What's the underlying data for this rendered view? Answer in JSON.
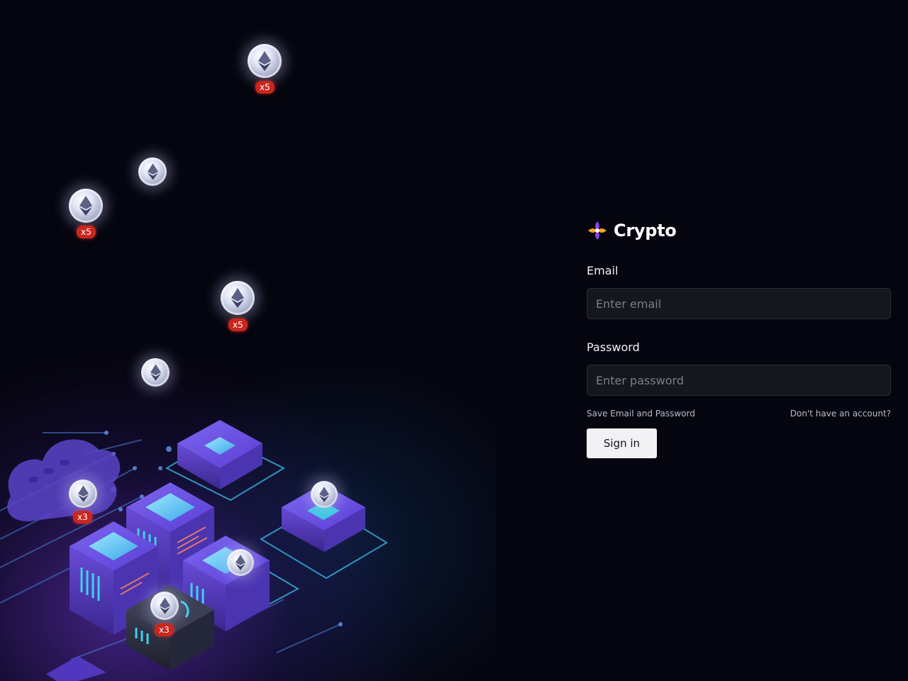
{
  "brand": {
    "name": "Crypto",
    "logo_icon": "flower-logo-icon",
    "logo_colors": [
      "#f5a623",
      "#8e44ec",
      "#ffffff"
    ]
  },
  "login": {
    "email_label": "Email",
    "email_placeholder": "Enter email",
    "email_value": "",
    "password_label": "Password",
    "password_placeholder": "Enter password",
    "password_value": "",
    "save_credentials_label": "Save Email and Password",
    "no_account_link": "Don't have an account?",
    "signin_label": "Sign in"
  },
  "illustration": {
    "coin_icon": "ethereum-coin-icon",
    "badges": [
      "x5",
      "x5",
      "x5",
      "x3",
      "x3"
    ],
    "accent_colors": {
      "purple": "#7b3fe4",
      "cyan": "#3fd0f0",
      "badge_red": "#c9261e"
    }
  }
}
